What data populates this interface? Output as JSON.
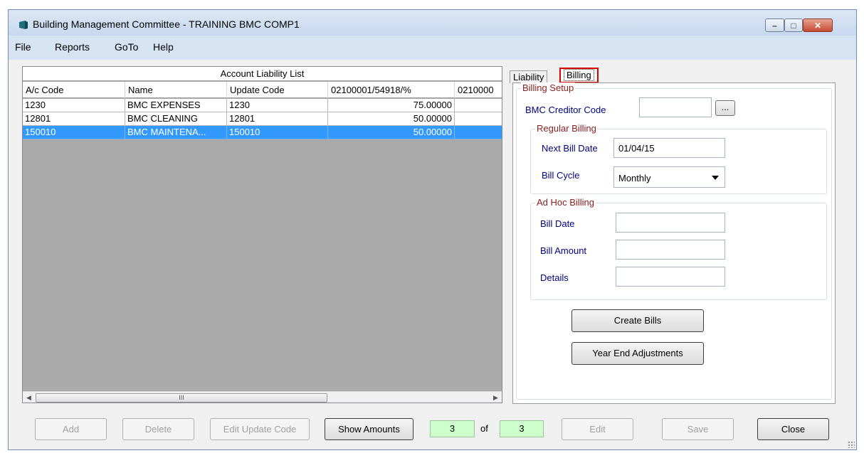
{
  "window": {
    "title": "Building Management Committee - TRAINING BMC COMP1",
    "controls": {
      "minimize": "–",
      "maximize": "□",
      "close": "✕"
    }
  },
  "menu": [
    {
      "label": "File"
    },
    {
      "label": "Reports"
    },
    {
      "label": "GoTo"
    },
    {
      "label": "Help"
    }
  ],
  "liability_list": {
    "caption": "Account Liability List",
    "columns": [
      "A/c Code",
      "Name",
      "Update Code",
      "02100001/54918/%",
      "0210000"
    ],
    "rows": [
      {
        "code": "1230",
        "name": "BMC EXPENSES",
        "update_code": "1230",
        "value": "75.00000"
      },
      {
        "code": "12801",
        "name": "BMC CLEANING",
        "update_code": "12801",
        "value": "50.00000"
      },
      {
        "code": "150010",
        "name": "BMC MAINTENA...",
        "update_code": "150010",
        "value": "50.00000"
      }
    ],
    "scroll_glyph": "III"
  },
  "tabs": {
    "liability": "Liability",
    "billing": "Billing"
  },
  "billing": {
    "setup_label": "Billing Setup",
    "creditor_code_label": "BMC Creditor Code",
    "creditor_code_value": "",
    "browse_label": "...",
    "regular": {
      "label": "Regular Billing",
      "next_bill_date_label": "Next Bill Date",
      "next_bill_date_value": "01/04/15",
      "bill_cycle_label": "Bill Cycle",
      "bill_cycle_value": "Monthly"
    },
    "adhoc": {
      "label": "Ad Hoc Billing",
      "bill_date_label": "Bill Date",
      "bill_date_value": "",
      "bill_amount_label": "Bill Amount",
      "bill_amount_value": "",
      "details_label": "Details",
      "details_value": ""
    },
    "create_bills_label": "Create Bills",
    "year_end_label": "Year End Adjustments"
  },
  "footer": {
    "add": "Add",
    "delete": "Delete",
    "edit_update_code": "Edit Update Code",
    "show_amounts": "Show Amounts",
    "current_record": "3",
    "of": "of",
    "total_records": "3",
    "edit": "Edit",
    "save": "Save",
    "close": "Close"
  },
  "colors": {
    "selection": "#3399ff",
    "group_label": "#8b1c1c",
    "field_label": "#000080",
    "counter_bg": "#ccffcc",
    "highlight_border": "#e00000"
  }
}
